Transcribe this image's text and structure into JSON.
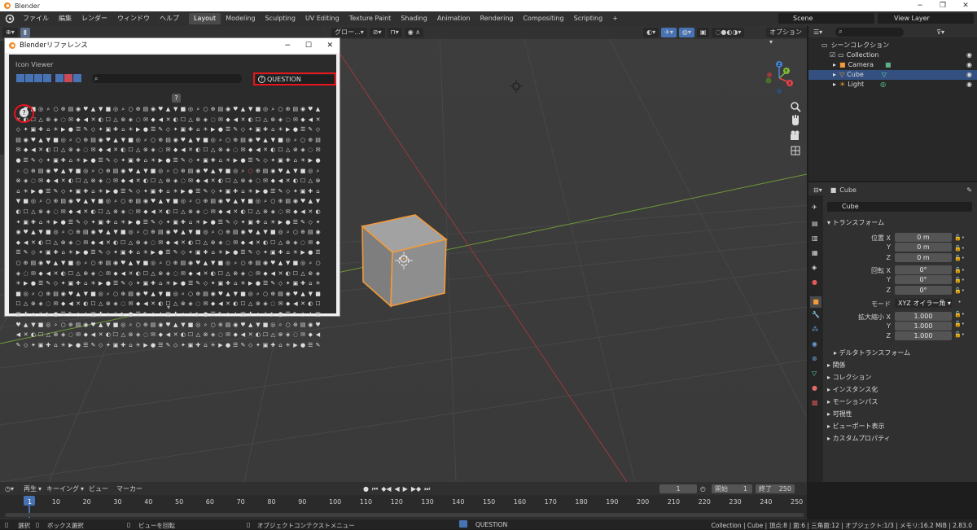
{
  "window": {
    "title": "Blender",
    "controls": [
      "−",
      "❐",
      "✕"
    ]
  },
  "menubar": {
    "menus": [
      "ファイル",
      "編集",
      "レンダー",
      "ウィンドウ",
      "ヘルプ"
    ],
    "workspaces": [
      "Layout",
      "Modeling",
      "Sculpting",
      "UV Editing",
      "Texture Paint",
      "Shading",
      "Animation",
      "Rendering",
      "Compositing",
      "Scripting"
    ],
    "active_workspace": "Layout",
    "add_tab": "+",
    "scene": "Scene",
    "view_layer": "View Layer"
  },
  "viewport": {
    "transform_orientation": "グロー...",
    "overlay_label": "オプション",
    "gizmo_axes": [
      "X",
      "Y",
      "Z"
    ]
  },
  "dialog": {
    "title": "Blenderリファレンス",
    "controls": [
      "−",
      "☐",
      "✕"
    ],
    "panel_title": "Icon Viewer",
    "search_placeholder": "",
    "selected_icon_name": "QUESTION",
    "scroll_down": "▾"
  },
  "outliner": {
    "root": "シーンコレクション",
    "items": [
      {
        "name": "Collection",
        "level": 1
      },
      {
        "name": "Camera",
        "level": 2
      },
      {
        "name": "Cube",
        "level": 2
      },
      {
        "name": "Light",
        "level": 2
      }
    ]
  },
  "properties": {
    "object_name": "Cube",
    "name_field": "Cube",
    "transform_header": "トランスフォーム",
    "location_label": "位置 X",
    "rotation_label": "回転 X",
    "scale_label": "拡大縮小 X",
    "y_label": "Y",
    "z_label": "Z",
    "location": [
      "0 m",
      "0 m",
      "0 m"
    ],
    "rotation": [
      "0°",
      "0°",
      "0°"
    ],
    "mode_label": "モード",
    "mode_value": "XYZ オイラー角",
    "scale": [
      "1.000",
      "1.000",
      "1.000"
    ],
    "delta_transform": "デルタトランスフォーム",
    "sections": [
      "関係",
      "コレクション",
      "インスタンス化",
      "モーションパス",
      "可視性",
      "ビューポート表示",
      "カスタムプロパティ"
    ]
  },
  "timeline": {
    "menus": [
      "再生",
      "キーイング",
      "ビュー",
      "マーカー"
    ],
    "current_frame": "1",
    "start_label": "開始",
    "start": "1",
    "end_label": "終了",
    "end": "250",
    "frames": [
      "1",
      "10",
      "20",
      "30",
      "40",
      "50",
      "60",
      "70",
      "80",
      "90",
      "100",
      "110",
      "120",
      "130",
      "140",
      "150",
      "160",
      "170",
      "180",
      "190",
      "200",
      "210",
      "220",
      "230",
      "240",
      "250"
    ]
  },
  "statusbar": {
    "select": "選択",
    "box_select": "ボックス選択",
    "rotate_view": "ビューを回転",
    "context_menu": "オブジェクトコンテクストメニュー",
    "icon_name": "QUESTION",
    "stats": "Collection | Cube | 頂点:8 | 面:6 | 三角面:12 | オブジェクト:1/3 | メモリ:16.2 MiB | 2.83.0"
  },
  "colors": {
    "accent": "#4772b3",
    "highlight_red": "#e8141e",
    "selection_orange": "#f29b3a",
    "x_axis": "#e8434f",
    "y_axis": "#7fb93b",
    "z_axis": "#4682d2"
  }
}
